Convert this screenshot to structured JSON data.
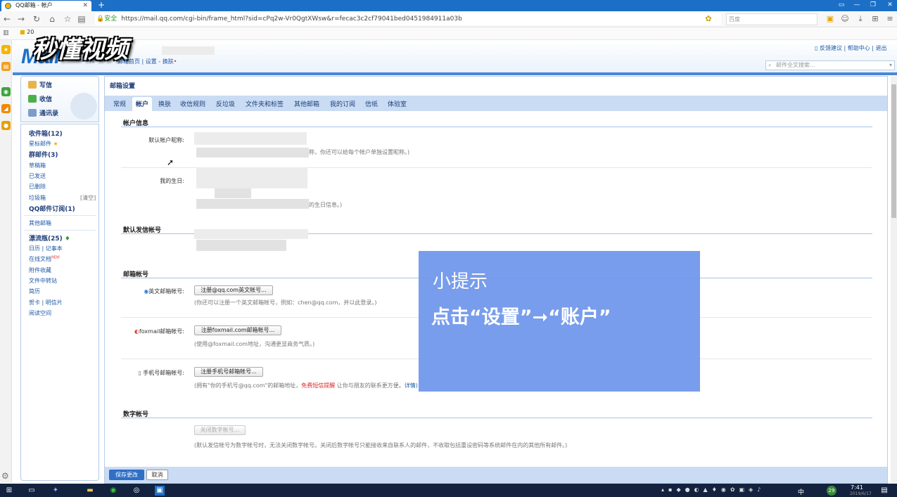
{
  "browser": {
    "tab_title": "QQ邮箱 - 帐户",
    "new_tab": "+",
    "secure_label": "安全",
    "url": "https://mail.qq.com/cgi-bin/frame_html?sid=cPq2w-Vr0QgtXWsw&r=fecac3c2cf79041bed0451984911a03b",
    "search_engine": "百度",
    "bookmark": "20"
  },
  "header": {
    "logo": "Mail",
    "logo_sub": "mail.qq.com",
    "watermark": "秒懂视频",
    "mail_home": "邮箱首页",
    "settings": "设置",
    "skin": "换肤",
    "feedback": "反馈建议",
    "help": "帮助中心",
    "logout": "退出",
    "search_placeholder": "邮件全文搜索..."
  },
  "sidebar": {
    "compose": "写信",
    "receive": "收信",
    "contacts": "通讯录",
    "inbox": "收件箱(12)",
    "starred": "星标邮件",
    "group": "群邮件(3)",
    "drafts": "草稿箱",
    "sent": "已发送",
    "deleted": "已删除",
    "spam": "垃圾箱",
    "clear": "[清空]",
    "subscriptions": "QQ邮件订阅(1)",
    "other": "其他邮箱",
    "drift": "漂流瓶(25)",
    "calendar": "日历",
    "notes": "记事本",
    "online_docs": "在线文档",
    "new_badge": "NEW",
    "attachments": "附件收藏",
    "transfer": "文件中转站",
    "resume": "简历",
    "card": "贺卡",
    "postcard": "明信片",
    "reading": "阅读空间"
  },
  "settings": {
    "title": "邮箱设置",
    "tabs": [
      "常规",
      "帐户",
      "换肤",
      "收信规则",
      "反垃圾",
      "文件夹和标签",
      "其他邮箱",
      "我的订阅",
      "信纸",
      "体验室"
    ],
    "account_info": "帐户信息",
    "default_nick_label": "默认帐户昵称:",
    "nick_hint": "称，你还可以给每个帐户单独设置昵称。)",
    "birthday_label": "我的生日:",
    "birthday_hint": "的生日信息。)",
    "default_sender": "默认发信帐号",
    "mail_accounts": "邮箱帐号",
    "english_label": "英文邮箱帐号:",
    "english_btn": "注册@qq.com英文帐号...",
    "english_hint": "(你还可以注册一个英文邮箱帐号，例如：chen@qq.com，并以此登录。)",
    "foxmail_label": "foxmail邮箱帐号:",
    "foxmail_btn": "注册foxmail.com邮箱帐号...",
    "foxmail_hint": "(使用@foxmail.com地址，沟通更显商务气质。)",
    "mobile_label": "手机号邮箱帐号:",
    "mobile_btn": "注册手机号邮箱帐号...",
    "mobile_hint_a": "(拥有\"你的手机号@qq.com\"的邮箱地址，",
    "mobile_hint_red": "免费短信提醒",
    "mobile_hint_b": " 让你与朋友的联系更方便。",
    "mobile_hint_link": "详情)",
    "digital_account": "数字帐号",
    "close_digital_btn": "关闭数字帐号...",
    "digital_hint": "(默认发信帐号为数字帐号时，无法关闭数字帐号。关闭后数字帐号只能接收来自联系人的邮件，不收取包括重设密码等系统邮件在内的其他所有邮件。)",
    "save": "保存更改",
    "cancel": "取消"
  },
  "overlay": {
    "title": "小提示",
    "text": "点击“设置”➞“账户”"
  },
  "taskbar": {
    "time": "7:41",
    "date": "2019/6/17",
    "lang": "中",
    "badge": "29"
  }
}
